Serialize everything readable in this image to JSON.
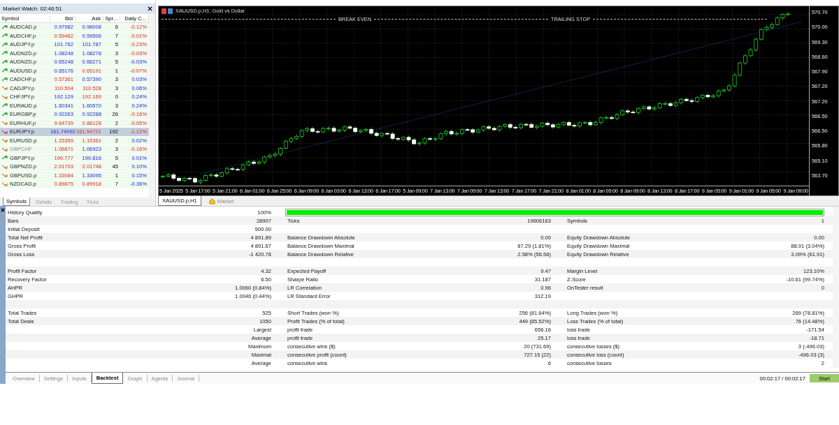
{
  "market_watch": {
    "title": "Market Watch: 02:46:51",
    "columns": [
      "Symbol",
      "Bid",
      "Ask",
      "Spr...",
      "Daily C..."
    ],
    "rows": [
      {
        "symbol": "AUDCAD.p",
        "bid": "0.97982",
        "bid_up": true,
        "ask": "0.98008",
        "ask_up": true,
        "spread": "6",
        "change": "-0.12%",
        "change_up": false,
        "trend_up": true,
        "selected": false,
        "disabled": false
      },
      {
        "symbol": "AUDCHF.p",
        "bid": "0.59482",
        "bid_up": false,
        "ask": "0.59506",
        "ask_up": true,
        "spread": "7",
        "change": "-0.01%",
        "change_up": false,
        "trend_up": true,
        "selected": false,
        "disabled": false
      },
      {
        "symbol": "AUDJPY.p",
        "bid": "101.762",
        "bid_up": true,
        "ask": "101.787",
        "ask_up": true,
        "spread": "5",
        "change": "-0.23%",
        "change_up": false,
        "trend_up": true,
        "selected": false,
        "disabled": false
      },
      {
        "symbol": "AUDNZD.p",
        "bid": "1.08248",
        "bid_up": true,
        "ask": "1.08278",
        "ask_up": true,
        "spread": "3",
        "change": "-0.03%",
        "change_up": false,
        "trend_up": true,
        "selected": false,
        "disabled": false
      },
      {
        "symbol": "AUDNZD.p",
        "bid": "0.65248",
        "bid_up": true,
        "ask": "0.66271",
        "ask_up": true,
        "spread": "5",
        "change": "-0.03%",
        "change_up": true,
        "trend_up": true,
        "selected": false,
        "disabled": false
      },
      {
        "symbol": "AUDUSD.p",
        "bid": "0.65176",
        "bid_up": true,
        "ask": "0.65191",
        "ask_up": false,
        "spread": "1",
        "change": "-0.07%",
        "change_up": false,
        "trend_up": true,
        "selected": false,
        "disabled": false
      },
      {
        "symbol": "CADCHF.p",
        "bid": "0.57361",
        "bid_up": false,
        "ask": "0.57390",
        "ask_up": true,
        "spread": "3",
        "change": "0.03%",
        "change_up": true,
        "trend_up": true,
        "selected": false,
        "disabled": false
      },
      {
        "symbol": "CADJPY.p",
        "bid": "110.504",
        "bid_up": false,
        "ask": "110.528",
        "ask_up": false,
        "spread": "3",
        "change": "0.06%",
        "change_up": true,
        "trend_up": false,
        "selected": false,
        "disabled": false
      },
      {
        "symbol": "CHFJPY.p",
        "bid": "192.129",
        "bid_up": true,
        "ask": "192.169",
        "ask_up": false,
        "spread": "0",
        "change": "0.24%",
        "change_up": true,
        "trend_up": false,
        "selected": false,
        "disabled": false
      },
      {
        "symbol": "EURAUD.p",
        "bid": "1.60341",
        "bid_up": true,
        "ask": "1.60570",
        "ask_up": true,
        "spread": "3",
        "change": "0.24%",
        "change_up": true,
        "trend_up": true,
        "selected": false,
        "disabled": false
      },
      {
        "symbol": "EURGBP.p",
        "bid": "0.92263",
        "bid_up": true,
        "ask": "0.92288",
        "ask_up": true,
        "spread": "26",
        "change": "-0.16%",
        "change_up": false,
        "trend_up": true,
        "selected": false,
        "disabled": false
      },
      {
        "symbol": "EURHUF.p",
        "bid": "9.64739",
        "bid_up": false,
        "ask": "0.88128",
        "ask_up": false,
        "spread": "2",
        "change": "-0.05%",
        "change_up": false,
        "trend_up": false,
        "selected": false,
        "disabled": false
      },
      {
        "symbol": "EURJPY.p",
        "bid": "161.74092",
        "bid_up": true,
        "ask": "161.54721",
        "ask_up": false,
        "spread": "192",
        "change": "-1.12%",
        "change_up": false,
        "trend_up": false,
        "selected": true,
        "disabled": false
      },
      {
        "symbol": "EURUSD.p",
        "bid": "1.15359",
        "bid_up": false,
        "ask": "1.15361",
        "ask_up": false,
        "spread": "2",
        "change": "0.02%",
        "change_up": true,
        "trend_up": false,
        "selected": false,
        "disabled": false
      },
      {
        "symbol": "GBPCHF",
        "bid": "1.06871",
        "bid_up": false,
        "ask": "1.06923",
        "ask_up": true,
        "spread": "3",
        "change": "-0.16%",
        "change_up": false,
        "trend_up": false,
        "selected": false,
        "disabled": true
      },
      {
        "symbol": "GBPJPY.p",
        "bid": "190.777",
        "bid_up": false,
        "ask": "190.816",
        "ask_up": true,
        "spread": "5",
        "change": "0.01%",
        "change_up": true,
        "trend_up": true,
        "selected": false,
        "disabled": false
      },
      {
        "symbol": "GBPNZD.p",
        "bid": "2.01703",
        "bid_up": false,
        "ask": "2.01748",
        "ask_up": false,
        "spread": "45",
        "change": "0.10%",
        "change_up": true,
        "trend_up": false,
        "selected": false,
        "disabled": false
      },
      {
        "symbol": "GBPUSD.p",
        "bid": "1.33084",
        "bid_up": false,
        "ask": "1.33095",
        "ask_up": true,
        "spread": "1",
        "change": "0.15%",
        "change_up": true,
        "trend_up": false,
        "selected": false,
        "disabled": false
      },
      {
        "symbol": "NZDCAD.p",
        "bid": "0.89875",
        "bid_up": false,
        "ask": "0.89918",
        "ask_up": false,
        "spread": "7",
        "change": "-0.36%",
        "change_up": true,
        "trend_up": false,
        "selected": false,
        "disabled": false
      }
    ],
    "tabs": [
      {
        "label": "Symbols",
        "selected": true
      },
      {
        "label": "Details",
        "selected": false
      },
      {
        "label": "Trading",
        "selected": false
      },
      {
        "label": "Ticks",
        "selected": false
      }
    ]
  },
  "chart": {
    "title": "XAUUSD.p,H1: Gold vs Dollar",
    "indicator_labels": [
      "BREAK EVEN",
      "TRAILING STOP"
    ],
    "y_axis_labels": [
      "570.70",
      "570.00",
      "569.30",
      "568.60",
      "567.90",
      "567.20",
      "567.20",
      "566.50",
      "566.50",
      "565.80",
      "565.10",
      "563.70"
    ],
    "x_axis_labels": [
      "5 Jan 2025",
      "5 Jan 17:00",
      "5 Jan 21:00",
      "6 Jan 01:00",
      "6 Jan 25:00",
      "6 Jan 09:00",
      "6 Jan 03:00",
      "6 Jan 13:00",
      "6 Jan 17:00",
      "5 Jan 09:00",
      "7 Jan 13:00",
      "7 Jan 09:00",
      "7 Jan 13:00",
      "7 Jan 17:00",
      "7 Jan 21:00",
      "8 Jan 01:00",
      "8 Jan 05:00",
      "8 Jan 09:00",
      "8 Jan 13:00",
      "8 Jan 17:00",
      "9 Jan 05:00",
      "9 Jan 01:00",
      "9 Jan 05:00",
      "9 Jan 09:00"
    ],
    "tabs": [
      {
        "label": "XAUUSD.p,H1",
        "selected": true,
        "kind": "chart"
      },
      {
        "label": "Market",
        "selected": false,
        "kind": "market"
      }
    ]
  },
  "report": {
    "rows": [
      {
        "kind": "quality",
        "label_1": "History Quality",
        "value_1": "100%",
        "level": 1
      },
      {
        "kind": "data",
        "label_1": "Bars",
        "value_1": "28907",
        "label_2": "Ticks",
        "value_2": "19606163",
        "label_3": "Symbols",
        "value_3": "1"
      },
      {
        "kind": "data",
        "label_1": "Initial Deposit",
        "value_1": "500.00"
      },
      {
        "kind": "data",
        "label_1": "Total Net Profit",
        "value_1": "4 891.89",
        "label_2": "Balance Drawdown Absolute",
        "value_2": "0.00",
        "label_3": "Equity Drawdown Absolute",
        "value_3": "0.00"
      },
      {
        "kind": "data",
        "label_1": "Gross Profit",
        "value_1": "4 891.67",
        "label_2": "Balance Drawdown Maximal",
        "value_2": "87.29 (1.81%)",
        "label_3": "Equity Drawdown Maximal",
        "value_3": "88.91 (3.04%)"
      },
      {
        "kind": "data",
        "label_1": "Gross Loss",
        "value_1": "-1 420.78",
        "label_2": "Balance Drawdown Relative",
        "value_2": "2.58% (56.56)",
        "label_3": "Equity Drawdown Relative",
        "value_3": "3.09% (61.91)"
      },
      {
        "kind": "spacer"
      },
      {
        "kind": "data",
        "label_1": "Profit Factor",
        "value_1": "4.32",
        "label_2": "Expected Payoff",
        "value_2": "9.47",
        "label_3": "Margin Level",
        "value_3": "123.10%"
      },
      {
        "kind": "data",
        "label_1": "Recovery Factor",
        "value_1": "6.50",
        "label_2": "Sharpe Ratio",
        "value_2": "31.187",
        "label_3": "Z-Score",
        "value_3": "-10.61 (99.74%)"
      },
      {
        "kind": "data",
        "label_1": "AHPR",
        "value_1": "1.0060 (0.84%)",
        "label_2": "LR Correlation",
        "value_2": "0.96",
        "label_3": "OnTester result",
        "value_3": "0"
      },
      {
        "kind": "data",
        "label_1": "GHPR",
        "value_1": "1.0046 (0.44%)",
        "label_2": "LR Standard Error",
        "value_2": "312.19"
      },
      {
        "kind": "spacer"
      },
      {
        "kind": "data",
        "label_1": "Total Trades",
        "value_1": "525",
        "label_2": "Short Trades (won %)",
        "value_2": "256 (81.64%)",
        "label_3": "Long Trades (won %)",
        "value_3": "269 (78.81%)"
      },
      {
        "kind": "data",
        "label_1": "Total Deals",
        "value_1": "1050",
        "label_2": "Profit Trades (% of total)",
        "value_2": "449 (85.52%)",
        "label_3": "Loss Trades (% of total)",
        "value_3": "76 (14.48%)"
      },
      {
        "kind": "data",
        "value_1": "Largest",
        "label_2": "profit trade",
        "value_2": "656.16",
        "label_3": "loss trade",
        "value_3": "-171.54"
      },
      {
        "kind": "data",
        "value_1": "Average",
        "label_2": "profit trade",
        "value_2": "25.17",
        "label_3": "loss trade",
        "value_3": "-18.71"
      },
      {
        "kind": "data",
        "value_1": "Maximum",
        "label_2": "consecutive wins ($)",
        "value_2": "20 (731.69)",
        "label_3": "consecutive losses ($)",
        "value_3": "3 (-496.03)"
      },
      {
        "kind": "data",
        "value_1": "Maximal",
        "label_2": "consecutive profit (count)",
        "value_2": "727.15 (22)",
        "label_3": "consecutive loss (count)",
        "value_3": "-496.03 (3)"
      },
      {
        "kind": "data",
        "value_1": "Average",
        "label_2": "consecutive wins",
        "value_2": "6",
        "label_3": "consecutive losses",
        "value_3": "2"
      }
    ]
  },
  "tester": {
    "tabs": [
      {
        "label": "Overview",
        "selected": false
      },
      {
        "label": "Settings",
        "selected": false
      },
      {
        "label": "Inputs",
        "selected": false
      },
      {
        "label": "Backtest",
        "selected": true
      },
      {
        "label": "Graph",
        "selected": false
      },
      {
        "label": "Agents",
        "selected": false
      },
      {
        "label": "Journal",
        "selected": false
      }
    ],
    "elapsed": "00:02:17 / 00:02:17",
    "start_button": "Start"
  }
}
